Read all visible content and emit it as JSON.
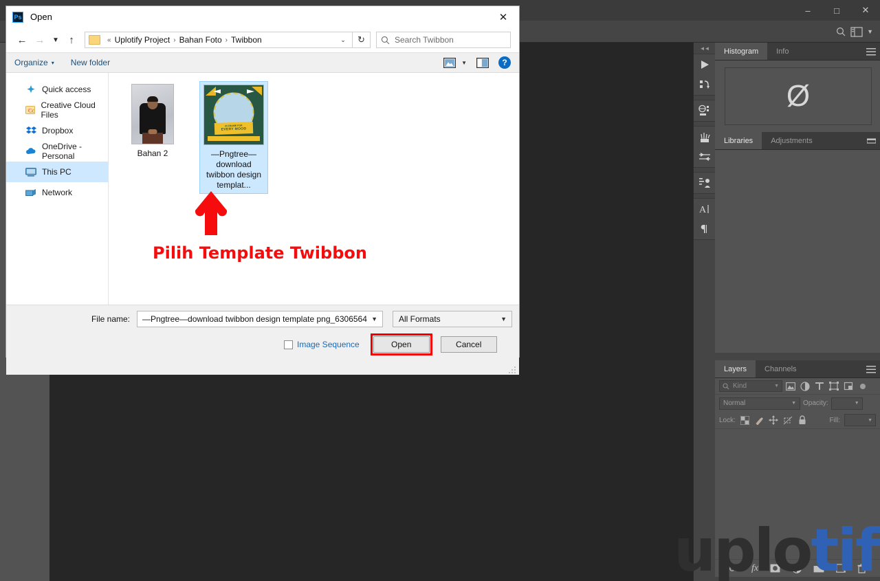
{
  "photoshop": {
    "window_controls": [
      "minimize",
      "maximize",
      "close"
    ],
    "options_bar_icons": [
      "search-icon",
      "workspace-icon",
      "chevron-down-icon"
    ],
    "tool_rail_icons": [
      "play-icon",
      "actions-icon",
      "3d-icon",
      "brush-presets-icon",
      "sliders-icon",
      "styles-icon",
      "character-icon",
      "paragraph-icon"
    ],
    "panels": {
      "histogram": {
        "tabs": [
          {
            "label": "Histogram",
            "active": true
          },
          {
            "label": "Info",
            "active": false
          }
        ],
        "empty_glyph": "Ø"
      },
      "libraries": {
        "tabs": [
          {
            "label": "Libraries",
            "active": true
          },
          {
            "label": "Adjustments",
            "active": false
          }
        ]
      },
      "layers": {
        "tabs": [
          {
            "label": "Layers",
            "active": true
          },
          {
            "label": "Channels",
            "active": false
          }
        ],
        "filter_kind": "Kind",
        "filter_icons": [
          "pixel-filter-icon",
          "adjustment-filter-icon",
          "type-filter-icon",
          "shape-filter-icon",
          "smart-object-filter-icon"
        ],
        "blend_mode": "Normal",
        "opacity_label": "Opacity:",
        "opacity_value": "",
        "lock_label": "Lock:",
        "lock_icons": [
          "lock-transparent-pixels-icon",
          "lock-image-pixels-icon",
          "lock-position-icon",
          "lock-artboard-nesting-icon",
          "lock-all-icon"
        ],
        "fill_label": "Fill:",
        "fill_value": "",
        "footer_icons": [
          "link-layers-icon",
          "layer-style-fx-icon",
          "layer-mask-icon",
          "adjustment-layer-icon",
          "new-group-icon",
          "new-layer-icon",
          "delete-layer-icon"
        ]
      }
    },
    "watermark": {
      "part_dark": "uplo",
      "part_blue": "tify",
      "blue": "#2f62b4",
      "dark": "#2f2f2f"
    }
  },
  "dialog": {
    "app_badge": "Ps",
    "title": "Open",
    "close_label": "✕",
    "nav": {
      "back_icon": "arrow-left-icon",
      "forward_icon": "arrow-right-icon",
      "recent_icon": "chevron-down-icon",
      "up_icon": "arrow-up-icon",
      "breadcrumb_prefix": "«",
      "breadcrumb": [
        "Uplotify Project",
        "Bahan Foto",
        "Twibbon"
      ],
      "breadcrumb_separator": "›",
      "dropdown_caret": "⌄",
      "refresh_icon": "↻"
    },
    "search": {
      "placeholder": "Search Twibbon",
      "icon": "search-icon"
    },
    "toolbar": {
      "organize_label": "Organize",
      "organize_caret": "▾",
      "new_folder_label": "New folder",
      "view_icon": "view-layout-icon",
      "view_caret": "▾",
      "preview_pane_icon": "preview-pane-icon",
      "help_label": "?"
    },
    "sidebar": {
      "items": [
        {
          "label": "Quick access",
          "icon": "pin-icon",
          "selected": false
        },
        {
          "label": "Creative Cloud Files",
          "icon": "creative-cloud-icon",
          "selected": false
        },
        {
          "label": "Dropbox",
          "icon": "dropbox-icon",
          "selected": false
        },
        {
          "label": "OneDrive - Personal",
          "icon": "onedrive-cloud-icon",
          "selected": false
        },
        {
          "label": "This PC",
          "icon": "this-pc-icon",
          "selected": true
        },
        {
          "label": "Network",
          "icon": "network-icon",
          "selected": false
        }
      ]
    },
    "files": [
      {
        "name": "Bahan 2",
        "type": "photo",
        "selected": false
      },
      {
        "name": "—Pngtree—download twibbon design templat...",
        "type": "twibbon",
        "selected": true
      }
    ],
    "twibbon_thumb": {
      "banner_line1": "IN FRAME FOR",
      "banner_line2": "EVERY MOOD",
      "bg_color": "#285744",
      "accent_color": "#f0c02a",
      "circle_color": "#b7d6e8"
    },
    "footer": {
      "file_name_label": "File name:",
      "file_name_value": "—Pngtree—download twibbon design template png_6306564",
      "format_value": "All Formats",
      "image_sequence_label": "Image Sequence",
      "image_sequence_checked": false,
      "open_label": "Open",
      "cancel_label": "Cancel",
      "open_highlight_color": "#f20000"
    }
  },
  "annotation": {
    "text": "Pilih Template Twibbon",
    "color": "#f60c0c",
    "arrow_icon": "up-arrow-annotation"
  }
}
